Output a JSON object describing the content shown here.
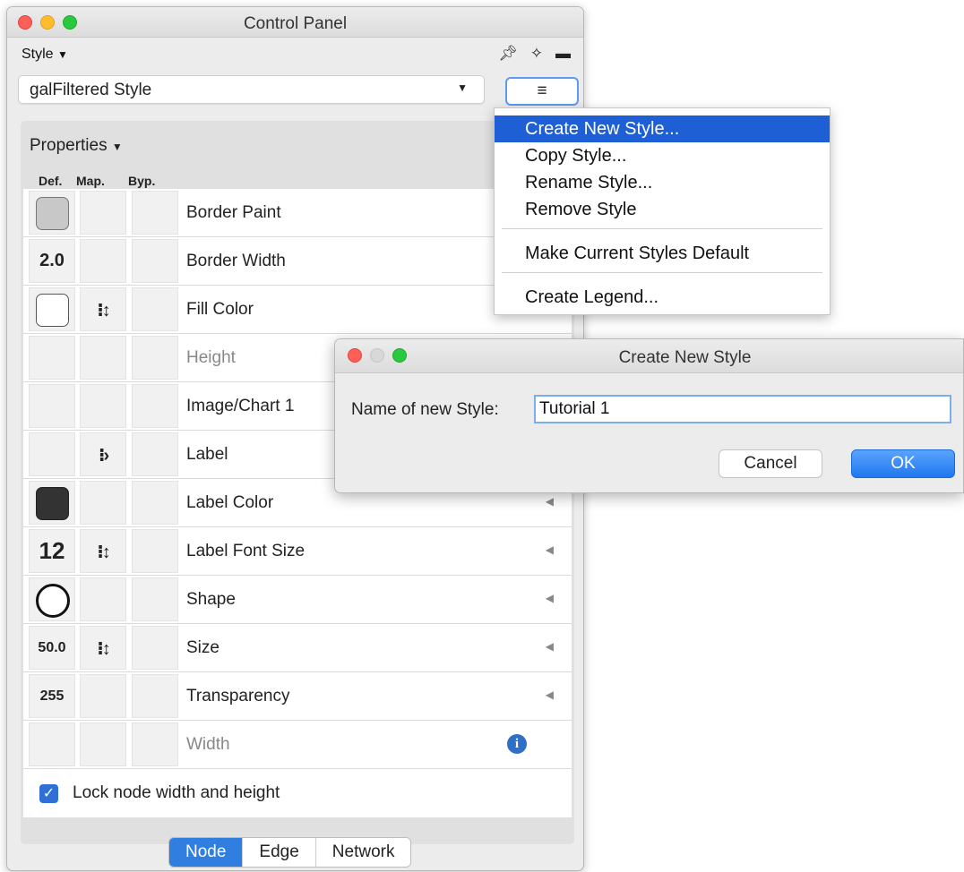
{
  "control_panel": {
    "title": "Control Panel",
    "style_menu_label": "Style",
    "current_style": "galFiltered Style",
    "properties_label": "Properties",
    "col_def": "Def.",
    "col_map": "Map.",
    "col_byp": "Byp.",
    "rows": [
      {
        "label": "Border Paint",
        "def": "",
        "map": ""
      },
      {
        "label": "Border Width",
        "def": "2.0",
        "map": ""
      },
      {
        "label": "Fill Color",
        "def": "",
        "map": "⁝↕"
      },
      {
        "label": "Height",
        "def": "",
        "map": ""
      },
      {
        "label": "Image/Chart 1",
        "def": "",
        "map": ""
      },
      {
        "label": "Label",
        "def": "",
        "map": "⁝›"
      },
      {
        "label": "Label Color",
        "def": "",
        "map": ""
      },
      {
        "label": "Label Font Size",
        "def": "12",
        "map": "⁝↕"
      },
      {
        "label": "Shape",
        "def": "",
        "map": ""
      },
      {
        "label": "Size",
        "def": "50.0",
        "map": "⁝↕"
      },
      {
        "label": "Transparency",
        "def": "255",
        "map": ""
      },
      {
        "label": "Width",
        "def": "",
        "map": ""
      }
    ],
    "lock_label": "Lock node width and height",
    "lock_checked": true,
    "tabs": [
      "Node",
      "Edge",
      "Network"
    ],
    "active_tab": "Node"
  },
  "style_menu": {
    "items": [
      "Create New Style...",
      "Copy Style...",
      "Rename Style...",
      "Remove Style",
      "Make Current Styles Default",
      "Create Legend..."
    ],
    "selected": "Create New Style..."
  },
  "dialog": {
    "title": "Create New Style",
    "field_label": "Name of new Style:",
    "field_value": "Tutorial 1",
    "cancel_label": "Cancel",
    "ok_label": "OK"
  },
  "colors": {
    "accent": "#2f7ee0",
    "menu_selection": "#1f5fd6",
    "label_color_swatch": "#333333",
    "border_paint_swatch": "#c8c8c8"
  }
}
